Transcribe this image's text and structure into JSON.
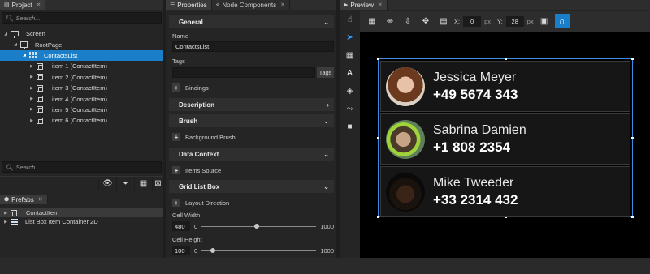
{
  "project": {
    "tab_label": "Project",
    "search_placeholder": "Search...",
    "tree": [
      {
        "label": "Screen"
      },
      {
        "label": "RootPage"
      },
      {
        "label": "ContactsList"
      },
      {
        "label": "item 1 (ContactItem)"
      },
      {
        "label": "item 2 (ContactItem)"
      },
      {
        "label": "item 3 (ContactItem)"
      },
      {
        "label": "item 4 (ContactItem)"
      },
      {
        "label": "item 5 (ContactItem)"
      },
      {
        "label": "item 6 (ContactItem)"
      }
    ],
    "search2_placeholder": "Search..."
  },
  "prefabs": {
    "tab_label": "Prefabs",
    "items": [
      {
        "label": "ContactItem"
      },
      {
        "label": "List Box Item Container 2D"
      }
    ]
  },
  "properties": {
    "tab_label": "Properties",
    "tab2_label": "Node Components",
    "general_label": "General",
    "name_label": "Name",
    "name_value": "ContactsList",
    "tags_label": "Tags",
    "tags_button": "Tags",
    "bindings_label": "Bindings",
    "description_label": "Description",
    "brush_label": "Brush",
    "background_brush_label": "Background Brush",
    "data_context_label": "Data Context",
    "items_source_label": "Items Source",
    "grid_list_box_label": "Grid List Box",
    "layout_direction_label": "Layout Direction",
    "cell_width_label": "Cell Width",
    "cell_width_value": "480",
    "cell_width_min": "0",
    "cell_width_max": "1000",
    "cell_width_fraction": 0.48,
    "cell_height_label": "Cell Height",
    "cell_height_value": "100",
    "cell_height_min": "0",
    "cell_height_max": "1000",
    "cell_height_fraction": 0.1
  },
  "preview": {
    "tab_label": "Preview",
    "x_label": "X:",
    "x_value": "0",
    "y_label": "Y:",
    "y_value": "28",
    "unit": "px",
    "contacts": [
      {
        "name": "Jessica Meyer",
        "phone": "+49 5674 343"
      },
      {
        "name": "Sabrina Damien",
        "phone": "+1 808 2354"
      },
      {
        "name": "Mike Tweeder",
        "phone": "+33 2314 432"
      }
    ]
  },
  "colors": {
    "accent": "#1a7fc8",
    "selection_frame": "#3a8ee6"
  }
}
